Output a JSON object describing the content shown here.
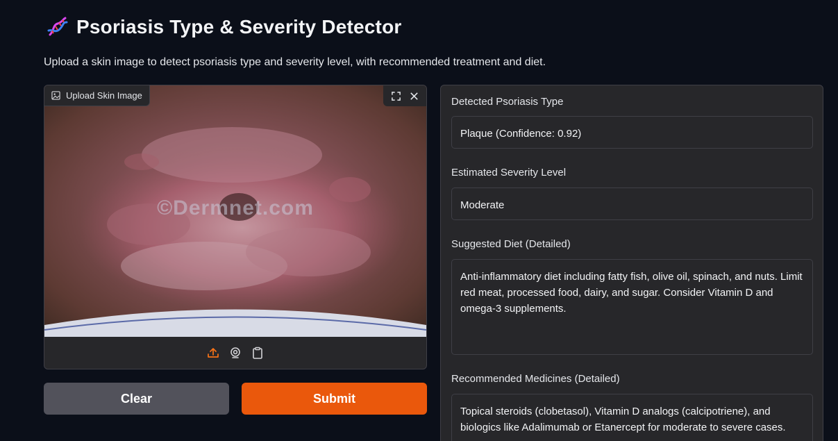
{
  "header": {
    "title_icon": "dna-icon",
    "title": "Psoriasis Type & Severity Detector",
    "subtitle": "Upload a skin image to detect psoriasis type and severity level, with recommended treatment and diet."
  },
  "image_input": {
    "label": "Upload Skin Image",
    "watermark": "©Dermnet.com",
    "controls": [
      "fullscreen-icon",
      "close-icon"
    ],
    "sources": [
      "upload-icon",
      "webcam-icon",
      "clipboard-icon"
    ],
    "active_source_color": "#f97316"
  },
  "buttons": {
    "clear_label": "Clear",
    "submit_label": "Submit",
    "clear_color": "#52525b",
    "submit_color": "#ea580c"
  },
  "outputs": {
    "type_label": "Detected Psoriasis Type",
    "type_value": "Plaque (Confidence: 0.92)",
    "severity_label": "Estimated Severity Level",
    "severity_value": "Moderate",
    "diet_label": "Suggested Diet (Detailed)",
    "diet_value": "Anti-inflammatory diet including fatty fish, olive oil, spinach, and nuts. Limit red meat, processed food, dairy, and sugar. Consider Vitamin D and omega-3 supplements.",
    "medicines_label": "Recommended Medicines (Detailed)",
    "medicines_value": "Topical steroids (clobetasol), Vitamin D analogs (calcipotriene), and biologics like Adalimumab or Etanercept for moderate to severe cases."
  }
}
